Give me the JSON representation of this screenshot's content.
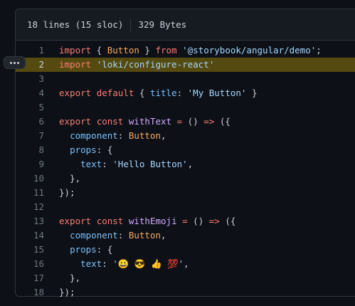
{
  "header": {
    "lines_info": "18 lines (15 sloc)",
    "size": "329 Bytes"
  },
  "colors": {
    "background": "#0d1117",
    "header_bg": "#161b22",
    "border": "#30363d",
    "highlight": "#554a10",
    "keyword": "#ff7b72",
    "string": "#a5d6ff",
    "function": "#d2a8ff",
    "class": "#ffa657",
    "property": "#79c0ff"
  },
  "highlighted_line": 2,
  "lines": [
    {
      "num": "1",
      "tokens": [
        {
          "t": "import",
          "c": "kw"
        },
        {
          "t": " { ",
          "c": "pl"
        },
        {
          "t": "Button",
          "c": "cls"
        },
        {
          "t": " } ",
          "c": "pl"
        },
        {
          "t": "from",
          "c": "kw"
        },
        {
          "t": " ",
          "c": "pl"
        },
        {
          "t": "'@storybook/angular/demo'",
          "c": "str"
        },
        {
          "t": ";",
          "c": "pl"
        }
      ]
    },
    {
      "num": "2",
      "tokens": [
        {
          "t": "import",
          "c": "kw"
        },
        {
          "t": " ",
          "c": "pl"
        },
        {
          "t": "'loki/configure-react'",
          "c": "str"
        }
      ]
    },
    {
      "num": "3",
      "tokens": []
    },
    {
      "num": "4",
      "tokens": [
        {
          "t": "export",
          "c": "kw"
        },
        {
          "t": " ",
          "c": "pl"
        },
        {
          "t": "default",
          "c": "kw"
        },
        {
          "t": " { ",
          "c": "pl"
        },
        {
          "t": "title",
          "c": "prop"
        },
        {
          "t": ": ",
          "c": "pl"
        },
        {
          "t": "'My Button'",
          "c": "str"
        },
        {
          "t": " }",
          "c": "pl"
        }
      ]
    },
    {
      "num": "5",
      "tokens": []
    },
    {
      "num": "6",
      "tokens": [
        {
          "t": "export",
          "c": "kw"
        },
        {
          "t": " ",
          "c": "pl"
        },
        {
          "t": "const",
          "c": "kw"
        },
        {
          "t": " ",
          "c": "pl"
        },
        {
          "t": "withText",
          "c": "fn"
        },
        {
          "t": " ",
          "c": "pl"
        },
        {
          "t": "=",
          "c": "kw"
        },
        {
          "t": " () ",
          "c": "pl"
        },
        {
          "t": "=>",
          "c": "kw"
        },
        {
          "t": " ({",
          "c": "pl"
        }
      ]
    },
    {
      "num": "7",
      "tokens": [
        {
          "t": "  ",
          "c": "pl"
        },
        {
          "t": "component",
          "c": "prop"
        },
        {
          "t": ": ",
          "c": "pl"
        },
        {
          "t": "Button",
          "c": "cls"
        },
        {
          "t": ",",
          "c": "pl"
        }
      ]
    },
    {
      "num": "8",
      "tokens": [
        {
          "t": "  ",
          "c": "pl"
        },
        {
          "t": "props",
          "c": "prop"
        },
        {
          "t": ": {",
          "c": "pl"
        }
      ]
    },
    {
      "num": "9",
      "tokens": [
        {
          "t": "    ",
          "c": "pl"
        },
        {
          "t": "text",
          "c": "prop"
        },
        {
          "t": ": ",
          "c": "pl"
        },
        {
          "t": "'Hello Button'",
          "c": "str"
        },
        {
          "t": ",",
          "c": "pl"
        }
      ]
    },
    {
      "num": "10",
      "tokens": [
        {
          "t": "  },",
          "c": "pl"
        }
      ]
    },
    {
      "num": "11",
      "tokens": [
        {
          "t": "});",
          "c": "pl"
        }
      ]
    },
    {
      "num": "12",
      "tokens": []
    },
    {
      "num": "13",
      "tokens": [
        {
          "t": "export",
          "c": "kw"
        },
        {
          "t": " ",
          "c": "pl"
        },
        {
          "t": "const",
          "c": "kw"
        },
        {
          "t": " ",
          "c": "pl"
        },
        {
          "t": "withEmoji",
          "c": "fn"
        },
        {
          "t": " ",
          "c": "pl"
        },
        {
          "t": "=",
          "c": "kw"
        },
        {
          "t": " () ",
          "c": "pl"
        },
        {
          "t": "=>",
          "c": "kw"
        },
        {
          "t": " ({",
          "c": "pl"
        }
      ]
    },
    {
      "num": "14",
      "tokens": [
        {
          "t": "  ",
          "c": "pl"
        },
        {
          "t": "component",
          "c": "prop"
        },
        {
          "t": ": ",
          "c": "pl"
        },
        {
          "t": "Button",
          "c": "cls"
        },
        {
          "t": ",",
          "c": "pl"
        }
      ]
    },
    {
      "num": "15",
      "tokens": [
        {
          "t": "  ",
          "c": "pl"
        },
        {
          "t": "props",
          "c": "prop"
        },
        {
          "t": ": {",
          "c": "pl"
        }
      ]
    },
    {
      "num": "16",
      "tokens": [
        {
          "t": "    ",
          "c": "pl"
        },
        {
          "t": "text",
          "c": "prop"
        },
        {
          "t": ": ",
          "c": "pl"
        },
        {
          "t": "'😀 😎 👍 💯'",
          "c": "str"
        },
        {
          "t": ",",
          "c": "pl"
        }
      ]
    },
    {
      "num": "17",
      "tokens": [
        {
          "t": "  },",
          "c": "pl"
        }
      ]
    },
    {
      "num": "18",
      "tokens": [
        {
          "t": "});",
          "c": "pl"
        }
      ]
    }
  ]
}
